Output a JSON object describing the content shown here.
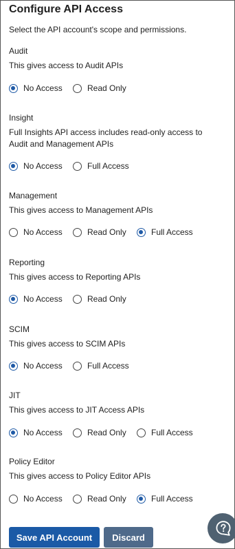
{
  "page": {
    "title": "Configure API Access",
    "subtitle": "Select the API account's scope and permissions."
  },
  "sections": [
    {
      "title": "Audit",
      "description": "This gives access to Audit APIs",
      "options": [
        {
          "label": "No Access",
          "selected": true
        },
        {
          "label": "Read Only",
          "selected": false
        }
      ]
    },
    {
      "title": "Insight",
      "description": "Full Insights API access includes read-only access to Audit and Management APIs",
      "options": [
        {
          "label": "No Access",
          "selected": true
        },
        {
          "label": "Full Access",
          "selected": false
        }
      ]
    },
    {
      "title": "Management",
      "description": "This gives access to Management APIs",
      "options": [
        {
          "label": "No Access",
          "selected": false
        },
        {
          "label": "Read Only",
          "selected": false
        },
        {
          "label": "Full Access",
          "selected": true
        }
      ]
    },
    {
      "title": "Reporting",
      "description": "This gives access to Reporting APIs",
      "options": [
        {
          "label": "No Access",
          "selected": true
        },
        {
          "label": "Read Only",
          "selected": false
        }
      ]
    },
    {
      "title": "SCIM",
      "description": "This gives access to SCIM APIs",
      "options": [
        {
          "label": "No Access",
          "selected": true
        },
        {
          "label": "Full Access",
          "selected": false
        }
      ]
    },
    {
      "title": "JIT",
      "description": "This gives access to JIT Access APIs",
      "options": [
        {
          "label": "No Access",
          "selected": true
        },
        {
          "label": "Read Only",
          "selected": false
        },
        {
          "label": "Full Access",
          "selected": false
        }
      ]
    },
    {
      "title": "Policy Editor",
      "description": "This gives access to Policy Editor APIs",
      "options": [
        {
          "label": "No Access",
          "selected": false
        },
        {
          "label": "Read Only",
          "selected": false
        },
        {
          "label": "Full Access",
          "selected": true
        }
      ]
    }
  ],
  "buttons": {
    "save": "Save API Account",
    "discard": "Discard"
  },
  "help": {
    "icon": "help-chat-icon"
  },
  "colors": {
    "primary": "#1b5aa6",
    "secondary": "#4f6a8a",
    "help_bg": "#4f6171",
    "border": "#555555"
  }
}
